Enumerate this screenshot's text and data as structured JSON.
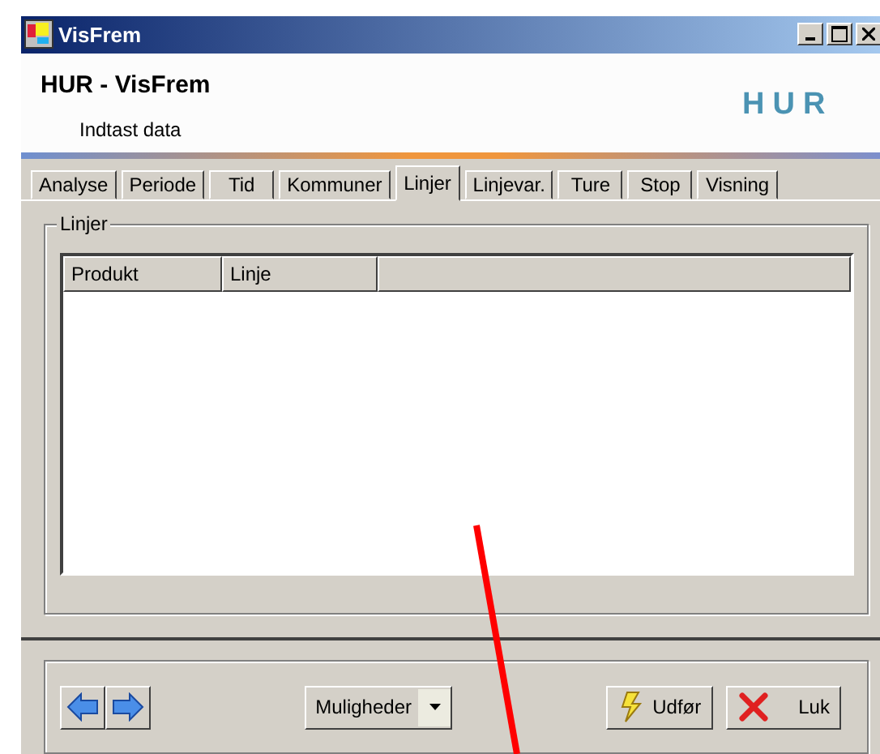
{
  "window": {
    "title": "VisFrem"
  },
  "header": {
    "title": "HUR - VisFrem",
    "subtitle": "Indtast data",
    "logo": "HUR"
  },
  "tabs": [
    {
      "label": "Analyse",
      "selected": false
    },
    {
      "label": "Periode",
      "selected": false
    },
    {
      "label": "Tid",
      "selected": false
    },
    {
      "label": "Kommuner",
      "selected": false
    },
    {
      "label": "Linjer",
      "selected": true
    },
    {
      "label": "Linjevar.",
      "selected": false
    },
    {
      "label": "Ture",
      "selected": false
    },
    {
      "label": "Stop",
      "selected": false
    },
    {
      "label": "Visning",
      "selected": false
    }
  ],
  "group": {
    "title": "Linjer",
    "columns": [
      "Produkt",
      "Linje"
    ]
  },
  "footer": {
    "options_button": "Muligheder",
    "buttons": [
      {
        "kind": "execute",
        "label": "Udfør"
      },
      {
        "kind": "close",
        "label": "Luk"
      }
    ]
  }
}
